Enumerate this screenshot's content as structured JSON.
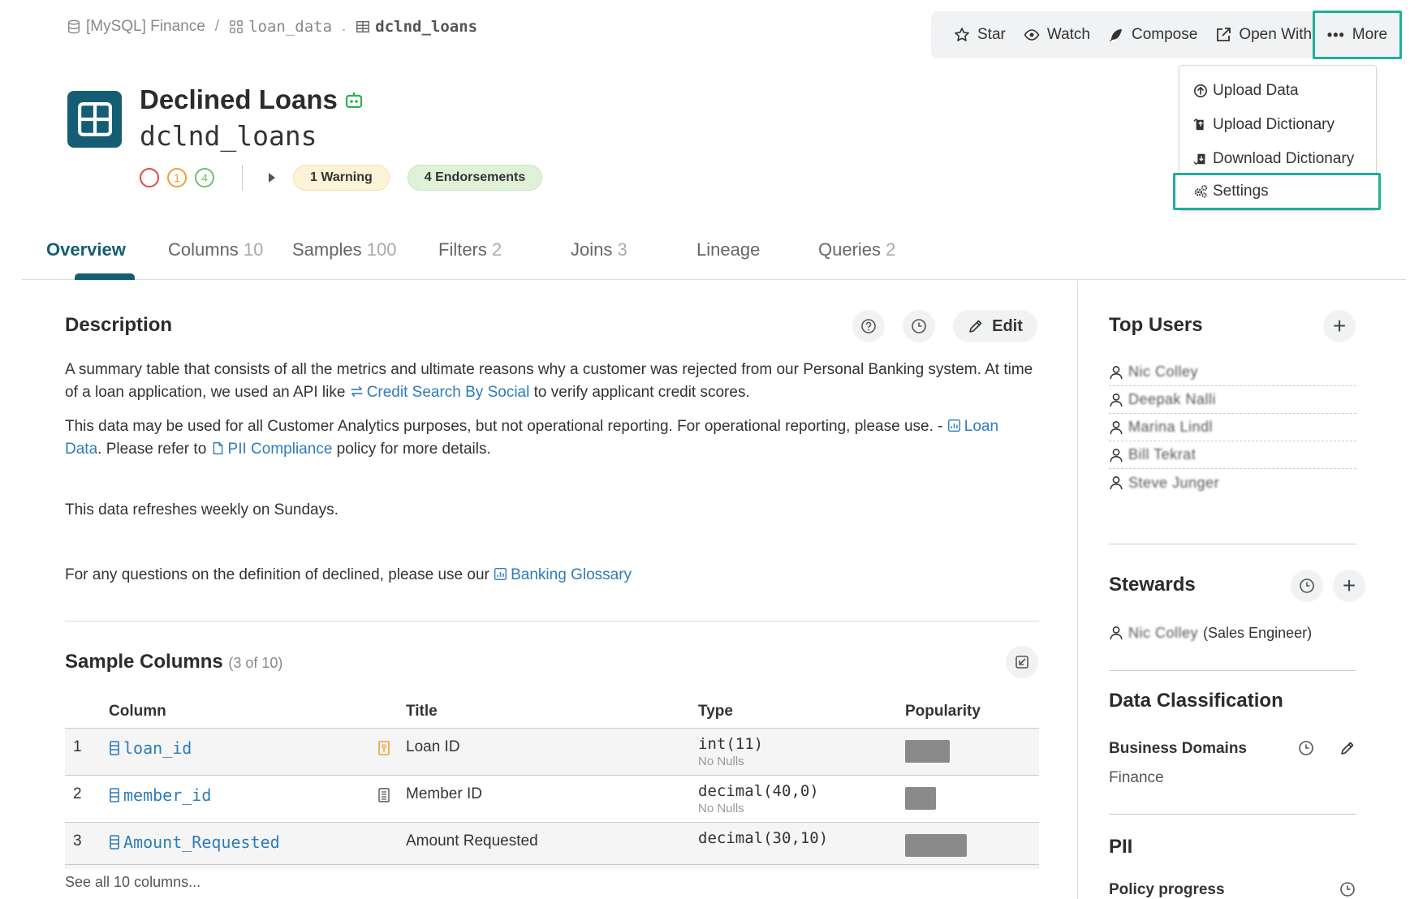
{
  "breadcrumb": {
    "source": "[MySQL] Finance",
    "schema": "loan_data",
    "separator": ".",
    "table": "dclnd_loans"
  },
  "actions": {
    "star": "Star",
    "watch": "Watch",
    "compose": "Compose",
    "open_with": "Open With",
    "more": "More"
  },
  "more_menu": {
    "items": [
      "Upload Data",
      "Upload Dictionary",
      "Download Dictionary",
      "Settings"
    ]
  },
  "header": {
    "title": "Declined Loans",
    "subtitle": "dclnd_loans",
    "status_counts": {
      "orange": "1",
      "green": "4"
    },
    "warning_badge": "1 Warning",
    "endorsement_badge": "4 Endorsements"
  },
  "tabs": [
    {
      "label": "Overview",
      "count": ""
    },
    {
      "label": "Columns",
      "count": "10"
    },
    {
      "label": "Samples",
      "count": "100"
    },
    {
      "label": "Filters",
      "count": "2"
    },
    {
      "label": "Joins",
      "count": "3"
    },
    {
      "label": "Lineage",
      "count": ""
    },
    {
      "label": "Queries",
      "count": "2"
    }
  ],
  "description": {
    "title": "Description",
    "edit_label": "Edit",
    "p1_a": "A summary table that consists of all the metrics and ultimate reasons why a customer was rejected from our Personal Banking system. At time of a loan application, we used an API like ",
    "p1_link": "Credit Search By Social",
    "p1_b": " to verify applicant credit scores.",
    "p2_a": "This data may be used for all Customer Analytics purposes, but not operational reporting. For operational reporting, please use. - ",
    "p2_link1": "Loan Data",
    "p2_b": ". Please refer to ",
    "p2_link2": "PII Compliance",
    "p2_c": "  policy for more details.",
    "p3": "This data refreshes weekly on Sundays.",
    "p4_a": "For any questions on the definition of declined, please use our ",
    "p4_link": "Banking Glossary"
  },
  "sample_columns": {
    "title": "Sample Columns",
    "subtitle": "(3 of 10)",
    "headers": [
      "Column",
      "Title",
      "Type",
      "Popularity"
    ],
    "rows": [
      {
        "num": "1",
        "column": "loan_id",
        "title": "Loan ID",
        "type": "int(11)",
        "nulls": "No Nulls",
        "popularity": 0.72
      },
      {
        "num": "2",
        "column": "member_id",
        "title": "Member ID",
        "type": "decimal(40,0)",
        "nulls": "No Nulls",
        "popularity": 0.5
      },
      {
        "num": "3",
        "column": "Amount_Requested",
        "title": "Amount Requested",
        "type": "decimal(30,10)",
        "nulls": "",
        "popularity": 1.0
      }
    ],
    "see_all": "See all 10 columns..."
  },
  "sidebar": {
    "top_users_title": "Top Users",
    "top_users": [
      "Nic Colley",
      "Deepak Nalli",
      "Marina Lindl",
      "Bill Tekrat",
      "Steve Junger"
    ],
    "stewards_title": "Stewards",
    "steward_name": "Nic Colley",
    "steward_role": " (Sales Engineer)",
    "data_classification_title": "Data Classification",
    "business_domains_label": "Business Domains",
    "business_domains_value": "Finance",
    "pii_title": "PII",
    "policy_progress_label": "Policy progress"
  }
}
